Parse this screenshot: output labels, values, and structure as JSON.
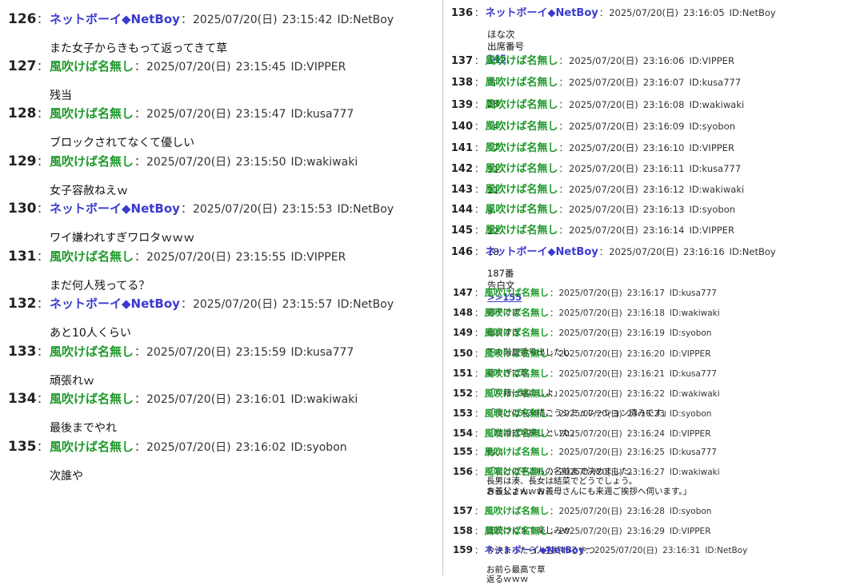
{
  "colors": {
    "netboy_name": "#3a3acf",
    "anon_name": "#1f9a2b",
    "link": "#3a3acf",
    "divider": "#c8c8c8"
  },
  "left_posts": [
    {
      "num": "126",
      "name": "ネットボーイ◆NetBoy",
      "kind": "nb",
      "date": "2025/07/20(日)",
      "time": "23:15:42",
      "id": "ID:NetBoy",
      "lines": [
        "また女子からきもって返ってきて草"
      ]
    },
    {
      "num": "127",
      "name": "風吹けば名無し",
      "kind": "an",
      "date": "2025/07/20(日)",
      "time": "23:15:45",
      "id": "ID:VIPPER",
      "lines": [
        "残当"
      ]
    },
    {
      "num": "128",
      "name": "風吹けば名無し",
      "kind": "an",
      "date": "2025/07/20(日)",
      "time": "23:15:47",
      "id": "ID:kusa777",
      "lines": [
        "ブロックされてなくて優しい"
      ]
    },
    {
      "num": "129",
      "name": "風吹けば名無し",
      "kind": "an",
      "date": "2025/07/20(日)",
      "time": "23:15:50",
      "id": "ID:wakiwaki",
      "lines": [
        "女子容赦ねえｗ"
      ]
    },
    {
      "num": "130",
      "name": "ネットボーイ◆NetBoy",
      "kind": "nb",
      "date": "2025/07/20(日)",
      "time": "23:15:53",
      "id": "ID:NetBoy",
      "lines": [
        "ワイ嫌われすぎワロタｗｗｗ"
      ]
    },
    {
      "num": "131",
      "name": "風吹けば名無し",
      "kind": "an",
      "date": "2025/07/20(日)",
      "time": "23:15:55",
      "id": "ID:VIPPER",
      "lines": [
        "まだ何人残ってる？"
      ]
    },
    {
      "num": "132",
      "name": "ネットボーイ◆NetBoy",
      "kind": "nb",
      "date": "2025/07/20(日)",
      "time": "23:15:57",
      "id": "ID:NetBoy",
      "lines": [
        "あと10人くらい"
      ]
    },
    {
      "num": "133",
      "name": "風吹けば名無し",
      "kind": "an",
      "date": "2025/07/20(日)",
      "time": "23:15:59",
      "id": "ID:kusa777",
      "lines": [
        "頑張れｗ"
      ]
    },
    {
      "num": "134",
      "name": "風吹けば名無し",
      "kind": "an",
      "date": "2025/07/20(日)",
      "time": "23:16:01",
      "id": "ID:wakiwaki",
      "lines": [
        "最後までやれ"
      ]
    },
    {
      "num": "135",
      "name": "風吹けば名無し",
      "kind": "an",
      "date": "2025/07/20(日)",
      "time": "23:16:02",
      "id": "ID:syobon",
      "lines": [
        "次誰や"
      ]
    }
  ],
  "right_posts": [
    {
      "num": "136",
      "name": "ネットボーイ◆NetBoy",
      "kind": "nb",
      "date": "2025/07/20(日)",
      "time": "23:16:05",
      "id": "ID:NetBoy",
      "lines": [
        "ほな次",
        "出席番号"
      ],
      "link": "145"
    },
    {
      "num": "137",
      "name": "風吹けば名無し",
      "kind": "an",
      "date": "2025/07/20(日)",
      "time": "23:16:06",
      "id": "ID:VIPPER",
      "lines": [
        "お"
      ]
    },
    {
      "num": "138",
      "name": "風吹けば名無し",
      "kind": "an",
      "date": "2025/07/20(日)",
      "time": "23:16:07",
      "id": "ID:kusa777",
      "lines": [
        "28"
      ]
    },
    {
      "num": "139",
      "name": "風吹けば名無し",
      "kind": "an",
      "date": "2025/07/20(日)",
      "time": "23:16:08",
      "id": "ID:wakiwaki",
      "lines": [
        "14"
      ]
    },
    {
      "num": "140",
      "name": "風吹けば名無し",
      "kind": "an",
      "date": "2025/07/20(日)",
      "time": "23:16:09",
      "id": "ID:syobon",
      "lines": [
        "17"
      ]
    },
    {
      "num": "141",
      "name": "風吹けば名無し",
      "kind": "an",
      "date": "2025/07/20(日)",
      "time": "23:16:10",
      "id": "ID:VIPPER",
      "lines": [
        "31"
      ]
    },
    {
      "num": "142",
      "name": "風吹けば名無し",
      "kind": "an",
      "date": "2025/07/20(日)",
      "time": "23:16:11",
      "id": "ID:kusa777",
      "lines": [
        "21"
      ]
    },
    {
      "num": "143",
      "name": "風吹けば名無し",
      "kind": "an",
      "date": "2025/07/20(日)",
      "time": "23:16:12",
      "id": "ID:wakiwaki",
      "lines": [
        "9"
      ]
    },
    {
      "num": "144",
      "name": "風吹けば名無し",
      "kind": "an",
      "date": "2025/07/20(日)",
      "time": "23:16:13",
      "id": "ID:syobon",
      "lines": [
        "22"
      ]
    },
    {
      "num": "145",
      "name": "風吹けば名無し",
      "kind": "an",
      "date": "2025/07/20(日)",
      "time": "23:16:14",
      "id": "ID:VIPPER",
      "lines": [
        "18"
      ]
    },
    {
      "num": "146",
      "name": "ネットボーイ◆NetBoy",
      "kind": "nb",
      "date": "2025/07/20(日)",
      "time": "23:16:16",
      "id": "ID:NetBoy",
      "lines": [
        "187番",
        "告白文"
      ],
      "link": ">>155"
    },
    {
      "num": "147",
      "name": "風吹けば名無し",
      "kind": "an",
      "date": "2025/07/20(日)",
      "time": "23:16:17",
      "id": "ID:kusa777",
      "lines": [
        "男子です"
      ]
    },
    {
      "num": "148",
      "name": "風吹けば名無し",
      "kind": "an",
      "date": "2025/07/20(日)",
      "time": "23:16:18",
      "id": "ID:wakiwaki",
      "lines": [
        "童貞すぎ"
      ]
    },
    {
      "num": "149",
      "name": "風吹けば名無し",
      "kind": "an",
      "date": "2025/07/20(日)",
      "time": "23:16:19",
      "id": "ID:syobon",
      "lines": [
        "下の階層番号出したし"
      ]
    },
    {
      "num": "150",
      "name": "風吹けば名無し",
      "kind": "an",
      "date": "2025/07/20(日)",
      "time": "23:16:20",
      "id": "ID:VIPPER",
      "lines": [
        "草すぎて草"
      ]
    },
    {
      "num": "151",
      "name": "風吹けば名無し",
      "kind": "an",
      "date": "2025/07/20(日)",
      "time": "23:16:21",
      "id": "ID:kusa777",
      "lines": [
        "「戸籍一緒にしよ」"
      ]
    },
    {
      "num": "152",
      "name": "風吹けば名無し",
      "kind": "an",
      "date": "2025/07/20(日)",
      "time": "23:16:22",
      "id": "ID:wakiwaki",
      "lines": [
        "「僕との未来描こうシミュレーション済みです」"
      ]
    },
    {
      "num": "153",
      "name": "風吹けば名無し",
      "kind": "an",
      "date": "2025/07/20(日)",
      "time": "23:16:23",
      "id": "ID:syobon",
      "lines": [
        "「結婚式場探しといた」"
      ]
    },
    {
      "num": "154",
      "name": "風吹けば名無し",
      "kind": "an",
      "date": "2025/07/20(日)",
      "time": "23:16:24",
      "id": "ID:VIPPER",
      "lines": [
        "怖い"
      ]
    },
    {
      "num": "155",
      "name": "風吹けば名無し",
      "kind": "an",
      "date": "2025/07/20(日)",
      "time": "23:16:25",
      "id": "ID:kusa777",
      "lines": [
        "「君との子どもの名前まで決めました。",
        "長男は湊、長女は結菜でどうでしょう。",
        "お義父さん、お義母さんにも来週ご挨拶へ伺います。」"
      ]
    },
    {
      "num": "156",
      "name": "風吹けば名無し",
      "kind": "an",
      "date": "2025/07/20(日)",
      "time": "23:16:27",
      "id": "ID:wakiwaki",
      "lines": [
        "きっしょｗｗｗ"
      ]
    },
    {
      "num": "157",
      "name": "風吹けば名無し",
      "kind": "an",
      "date": "2025/07/20(日)",
      "time": "23:16:28",
      "id": "ID:syobon",
      "lines": [
        "既読つくまで楽しみｗ"
      ]
    },
    {
      "num": "158",
      "name": "風吹けば名無し",
      "kind": "an",
      "date": "2025/07/20(日)",
      "time": "23:16:29",
      "id": "ID:VIPPER",
      "lines": [
        "今決まったら人生終わるやつ"
      ]
    },
    {
      "num": "159",
      "name": "ネットボーイ◆NetBoy",
      "kind": "nb",
      "date": "2025/07/20(日)",
      "time": "23:16:31",
      "id": "ID:NetBoy",
      "lines": [
        "お前ら最高で草",
        "返るｗｗｗ"
      ]
    }
  ]
}
